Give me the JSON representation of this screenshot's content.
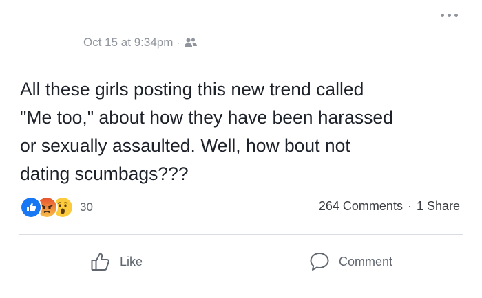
{
  "post": {
    "timestamp": "Oct 15 at 9:34pm",
    "separator": "·",
    "audience_icon": "friends-icon",
    "text": "All these girls posting this new trend called\n\"Me too,\" about how they have been harassed\nor sexually assaulted. Well,  how bout not\ndating scumbags???"
  },
  "reactions": {
    "icons": [
      "like-reaction-icon",
      "angry-reaction-icon",
      "wow-reaction-icon"
    ],
    "count": "30"
  },
  "stats": {
    "comments": "264 Comments",
    "separator": "·",
    "shares": "1 Share"
  },
  "actions": {
    "like_label": "Like",
    "comment_label": "Comment"
  },
  "colors": {
    "like_blue": "#1877f2",
    "angry_orange": "#f0663c",
    "wow_yellow": "#fbcb3b",
    "secondary_text": "#606770",
    "meta_text": "#90949c"
  }
}
